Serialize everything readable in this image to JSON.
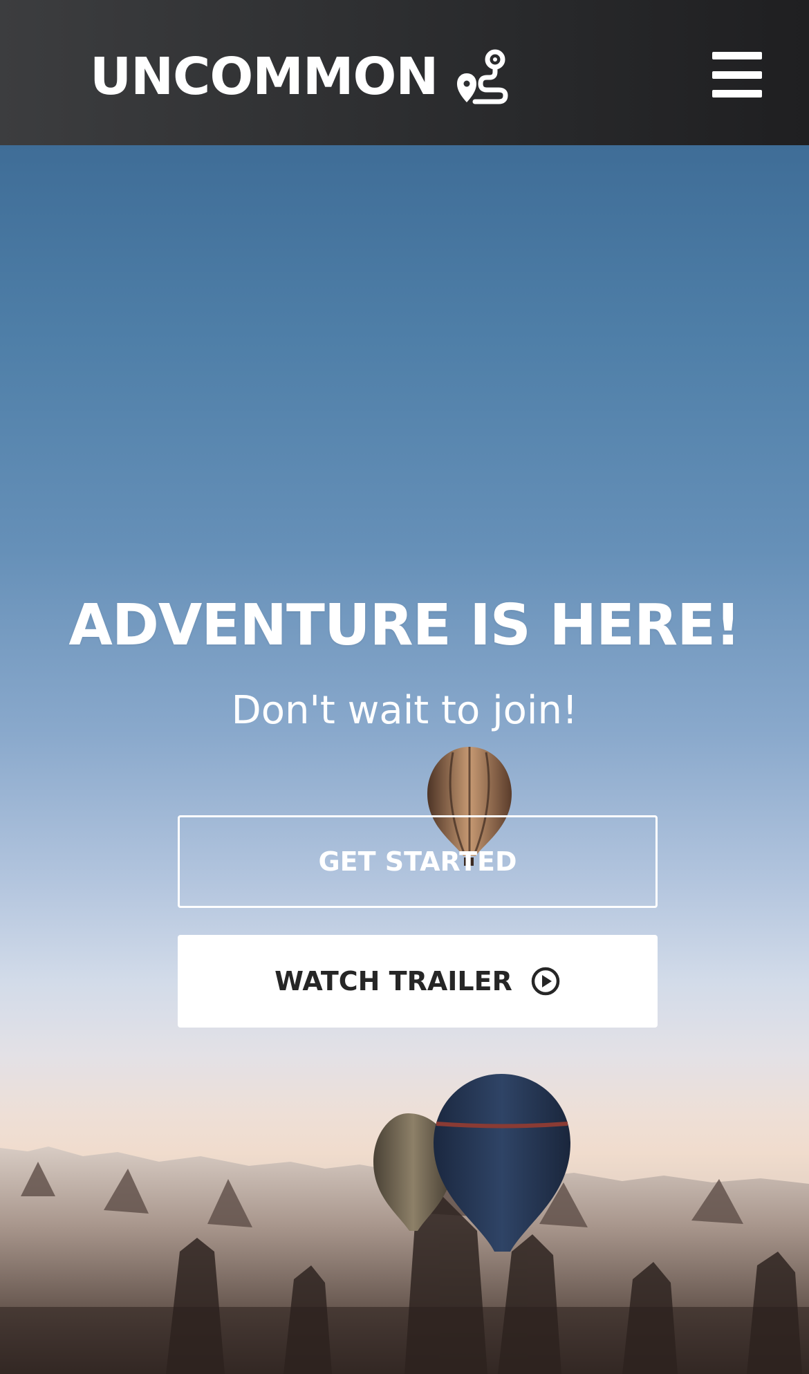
{
  "navbar": {
    "brand": "UNCOMMON",
    "brand_icon": "route-pin-icon",
    "menu_icon": "hamburger-menu-icon"
  },
  "hero": {
    "headline": "ADVENTURE IS HERE!",
    "subheadline": "Don't wait to join!",
    "primary_button": "GET STARTED",
    "secondary_button": "WATCH TRAILER",
    "secondary_icon": "play-circle-icon",
    "background": "hot-air-balloons-over-rock-valley"
  }
}
